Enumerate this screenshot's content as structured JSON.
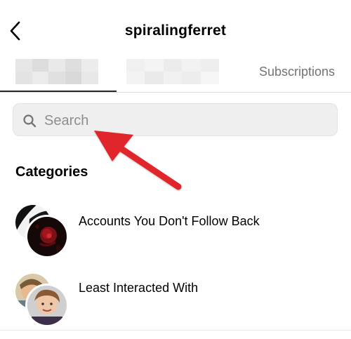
{
  "header": {
    "title": "spiralingferret",
    "back_icon": "chevron-left-icon"
  },
  "tabs": [
    {
      "label": "",
      "state": "active",
      "content": "blurred"
    },
    {
      "label": "",
      "state": "inactive",
      "content": "blurred"
    },
    {
      "label": "Subscriptions",
      "state": "inactive"
    }
  ],
  "search": {
    "placeholder": "Search",
    "value": "",
    "icon": "search-icon"
  },
  "annotation": {
    "icon": "red-arrow-icon",
    "color": "#e0262c"
  },
  "categories": {
    "heading": "Categories",
    "items": [
      {
        "label": "Accounts You Don't Follow Back",
        "icon": "stacked-avatars-icon"
      },
      {
        "label": "Least Interacted With",
        "icon": "stacked-avatars-icon"
      }
    ]
  }
}
